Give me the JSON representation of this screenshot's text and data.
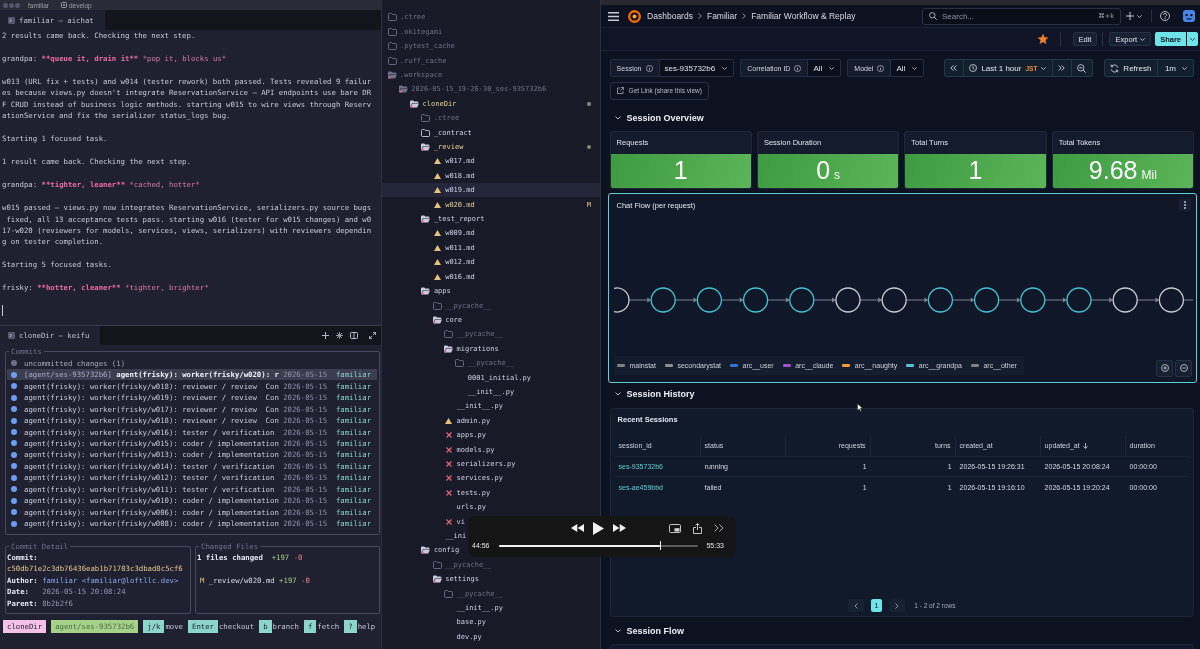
{
  "terminal_window": {
    "title": "familiar",
    "branch": "develop"
  },
  "chat_pane": {
    "tab": "familiar — aichat",
    "lines": [
      {
        "kind": "text",
        "text": "2 results came back. Checking the next step."
      },
      {
        "kind": "voice",
        "speaker": "grandpa:",
        "strong": "**queue it, drain it**",
        "soft": "*pop it, blocks us*"
      },
      {
        "kind": "text",
        "text": "w013 (URL fix + tests) and w014 (tester rework) both passed. Tests revealed 9 failures because views.py doesn't integrate ReservationService — API endpoints use bare DRF CRUD instead of business logic methods. starting w015 to wire views through ReservationService and fix the serializer status_logs bug."
      },
      {
        "kind": "text",
        "text": "Starting 1 focused task."
      },
      {
        "kind": "text",
        "text": "1 result came back. Checking the next step."
      },
      {
        "kind": "voice",
        "speaker": "grandpa:",
        "strong": "**tighter, leaner**",
        "soft": "*cached, hotter*"
      },
      {
        "kind": "text",
        "text": "w015 passed — views.py now integrates ReservationService, serializers.py source bugs fixed, all 13 acceptance tests pass. starting w016 (tester for w015 changes) and w017-w020 (reviewers for models, services, views, serializers) with reviewers depending on tester completion."
      },
      {
        "kind": "text",
        "text": "Starting 5 focused tasks."
      },
      {
        "kind": "voice",
        "speaker": "frisky:",
        "strong": "**hotter, cleaner**",
        "soft": "*tighter, brighter*"
      }
    ]
  },
  "git_pane": {
    "tab": "cloneDir — keifu",
    "commits": {
      "title": "Commits",
      "items": [
        {
          "kind": "pending",
          "message": "uncommitted changes (1)",
          "selected": false
        },
        {
          "kind": "commit",
          "ref": "[agent/ses-935732b6]",
          "message": "agent(frisky): worker(frisky/w020): r",
          "date": "2026-05-15",
          "author": "familiar",
          "selected": true
        },
        {
          "kind": "commit",
          "message": "agent(frisky): worker(frisky/w018): reviewer / review  Con",
          "date": "2026-05-15",
          "author": "familiar",
          "selected": false
        },
        {
          "kind": "commit",
          "message": "agent(frisky): worker(frisky/w019): reviewer / review  Con",
          "date": "2026-05-15",
          "author": "familiar",
          "selected": false
        },
        {
          "kind": "commit",
          "message": "agent(frisky): worker(frisky/w017): reviewer / review  Con",
          "date": "2026-05-15",
          "author": "familiar",
          "selected": false
        },
        {
          "kind": "commit",
          "message": "agent(frisky): worker(frisky/w018): reviewer / review  Con",
          "date": "2026-05-15",
          "author": "familiar",
          "selected": false
        },
        {
          "kind": "commit",
          "message": "agent(frisky): worker(frisky/w016): tester / verification",
          "date": "2026-05-15",
          "author": "familiar",
          "selected": false
        },
        {
          "kind": "commit",
          "message": "agent(frisky): worker(frisky/w015): coder / implementation",
          "date": "2026-05-15",
          "author": "familiar",
          "selected": false
        },
        {
          "kind": "commit",
          "message": "agent(frisky): worker(frisky/w013): coder / implementation",
          "date": "2026-05-15",
          "author": "familiar",
          "selected": false
        },
        {
          "kind": "commit",
          "message": "agent(frisky): worker(frisky/w014): tester / verification",
          "date": "2026-05-15",
          "author": "familiar",
          "selected": false
        },
        {
          "kind": "commit",
          "message": "agent(frisky): worker(frisky/w012): tester / verification",
          "date": "2026-05-15",
          "author": "familiar",
          "selected": false
        },
        {
          "kind": "commit",
          "message": "agent(frisky): worker(frisky/w011): tester / verification",
          "date": "2026-05-15",
          "author": "familiar",
          "selected": false
        },
        {
          "kind": "commit",
          "message": "agent(frisky): worker(frisky/w010): coder / implementation",
          "date": "2026-05-15",
          "author": "familiar",
          "selected": false
        },
        {
          "kind": "commit",
          "message": "agent(frisky): worker(frisky/w006): coder / implementation",
          "date": "2026-05-15",
          "author": "familiar",
          "selected": false
        },
        {
          "kind": "commit",
          "message": "agent(frisky): worker(frisky/w008): coder / implementation",
          "date": "2026-05-15",
          "author": "familiar",
          "selected": false
        }
      ]
    },
    "detail": {
      "title": "Commit Detail",
      "fields": [
        {
          "label": "Commit:",
          "value": "c50db71e2c3db76436eab1b71703c3dbad8c5cf6",
          "kind": "hash"
        },
        {
          "label": "Author:",
          "value": "familiar <familiar@loftllc.dev>",
          "kind": "author"
        },
        {
          "label": "Date:",
          "value": "2026-05-15 20:08:24",
          "kind": "plain"
        },
        {
          "label": "Parent:",
          "value": "8b2b2f6",
          "kind": "plain"
        }
      ]
    },
    "changes": {
      "title": "Changed Files",
      "summary": "1 files changed",
      "added": "+197",
      "removed": "-0",
      "files": [
        {
          "status": "M",
          "path": "_review/w020.md",
          "added": "+197",
          "removed": "-0"
        }
      ]
    },
    "status_bar": [
      {
        "kind": "dir",
        "text": "cloneDir"
      },
      {
        "kind": "branch",
        "text": "agent/ses-935732b6"
      },
      {
        "kind": "key",
        "key": "j/k",
        "label": "move"
      },
      {
        "kind": "key",
        "key": "Enter",
        "label": "checkout"
      },
      {
        "kind": "key",
        "key": "b",
        "label": "branch"
      },
      {
        "kind": "key",
        "key": "f",
        "label": "fetch"
      },
      {
        "kind": "key",
        "key": "?",
        "label": "help"
      }
    ]
  },
  "file_tree": {
    "items": [
      {
        "name": ".ctree",
        "kind": "folder",
        "expanded": false,
        "ignored": true,
        "modified": false,
        "selected": false
      },
      {
        "name": ".okitegami",
        "kind": "folder",
        "expanded": false,
        "ignored": true,
        "modified": false,
        "selected": false
      },
      {
        "name": ".pytest_cache",
        "kind": "folder",
        "expanded": false,
        "ignored": true,
        "modified": false,
        "selected": false
      },
      {
        "name": ".ruff_cache",
        "kind": "folder",
        "expanded": false,
        "ignored": true,
        "modified": false,
        "selected": false
      },
      {
        "name": ".workspace",
        "kind": "folder",
        "expanded": true,
        "ignored": true,
        "modified": false,
        "selected": false,
        "children": [
          {
            "name": "2026-05-15_19-26-30_ses-935732b6",
            "kind": "folder",
            "expanded": true,
            "ignored": true,
            "modified": false,
            "selected": false,
            "children": [
              {
                "name": "cloneDir",
                "kind": "folder",
                "expanded": true,
                "ignored": false,
                "modified": true,
                "selected": false,
                "children": [
                  {
                    "name": ".ctree",
                    "kind": "folder",
                    "expanded": false,
                    "ignored": true,
                    "modified": false,
                    "selected": false
                  },
                  {
                    "name": "_contract",
                    "kind": "folder",
                    "expanded": false,
                    "ignored": false,
                    "modified": false,
                    "selected": false
                  },
                  {
                    "name": "_review",
                    "kind": "folder",
                    "expanded": true,
                    "ignored": false,
                    "modified": true,
                    "selected": false,
                    "children": [
                      {
                        "name": "w017.md",
                        "kind": "warning",
                        "ignored": false,
                        "modified": false,
                        "selected": false
                      },
                      {
                        "name": "w018.md",
                        "kind": "warning",
                        "ignored": false,
                        "modified": false,
                        "selected": false
                      },
                      {
                        "name": "w019.md",
                        "kind": "warning",
                        "ignored": false,
                        "modified": false,
                        "selected": true
                      },
                      {
                        "name": "w020.md",
                        "kind": "warning",
                        "ignored": false,
                        "modified": true,
                        "badge": "M",
                        "selected": false
                      }
                    ]
                  },
                  {
                    "name": "_test_report",
                    "kind": "folder",
                    "expanded": true,
                    "ignored": false,
                    "modified": false,
                    "selected": false,
                    "children": [
                      {
                        "name": "w009.md",
                        "kind": "warning",
                        "ignored": false,
                        "modified": false,
                        "selected": false
                      },
                      {
                        "name": "w011.md",
                        "kind": "warning",
                        "ignored": false,
                        "modified": false,
                        "selected": false
                      },
                      {
                        "name": "w012.md",
                        "kind": "warning",
                        "ignored": false,
                        "modified": false,
                        "selected": false
                      },
                      {
                        "name": "w016.md",
                        "kind": "warning",
                        "ignored": false,
                        "modified": false,
                        "selected": false
                      }
                    ]
                  },
                  {
                    "name": "apps",
                    "kind": "folder",
                    "expanded": true,
                    "ignored": false,
                    "modified": false,
                    "selected": false,
                    "children": [
                      {
                        "name": "__pycache__",
                        "kind": "folder",
                        "expanded": false,
                        "ignored": true,
                        "modified": false,
                        "selected": false
                      },
                      {
                        "name": "core",
                        "kind": "folder",
                        "expanded": true,
                        "ignored": false,
                        "modified": false,
                        "selected": false,
                        "children": [
                          {
                            "name": "__pycache__",
                            "kind": "folder",
                            "expanded": false,
                            "ignored": true,
                            "modified": false,
                            "selected": false
                          },
                          {
                            "name": "migrations",
                            "kind": "folder",
                            "expanded": true,
                            "ignored": false,
                            "modified": false,
                            "selected": false,
                            "children": [
                              {
                                "name": "__pycache__",
                                "kind": "folder",
                                "expanded": false,
                                "ignored": true,
                                "modified": false,
                                "selected": false
                              },
                              {
                                "name": "0001_initial.py",
                                "kind": "plain",
                                "ignored": false,
                                "modified": false,
                                "selected": false
                              },
                              {
                                "name": "__init__.py",
                                "kind": "plain",
                                "ignored": false,
                                "modified": false,
                                "selected": false
                              }
                            ]
                          },
                          {
                            "name": "__init__.py",
                            "kind": "plain",
                            "ignored": false,
                            "modified": false,
                            "selected": false
                          },
                          {
                            "name": "admin.py",
                            "kind": "warning",
                            "ignored": false,
                            "modified": false,
                            "selected": false
                          },
                          {
                            "name": "apps.py",
                            "kind": "error",
                            "ignored": false,
                            "modified": false,
                            "selected": false
                          },
                          {
                            "name": "models.py",
                            "kind": "error",
                            "ignored": false,
                            "modified": false,
                            "selected": false
                          },
                          {
                            "name": "serializers.py",
                            "kind": "error",
                            "ignored": false,
                            "modified": false,
                            "selected": false
                          },
                          {
                            "name": "services.py",
                            "kind": "error",
                            "ignored": false,
                            "modified": false,
                            "selected": false
                          },
                          {
                            "name": "tests.py",
                            "kind": "error",
                            "ignored": false,
                            "modified": false,
                            "selected": false
                          },
                          {
                            "name": "urls.py",
                            "kind": "plain",
                            "ignored": false,
                            "modified": false,
                            "selected": false
                          },
                          {
                            "name": "vi",
                            "kind": "error",
                            "ignored": false,
                            "modified": false,
                            "selected": false
                          }
                        ]
                      },
                      {
                        "name": "__ini",
                        "kind": "plain",
                        "ignored": false,
                        "modified": false,
                        "selected": false
                      }
                    ]
                  },
                  {
                    "name": "config",
                    "kind": "folder",
                    "expanded": true,
                    "ignored": false,
                    "modified": false,
                    "selected": false,
                    "children": [
                      {
                        "name": "__pycache__",
                        "kind": "folder",
                        "expanded": false,
                        "ignored": true,
                        "modified": false,
                        "selected": false
                      },
                      {
                        "name": "settings",
                        "kind": "folder",
                        "expanded": true,
                        "ignored": false,
                        "modified": false,
                        "selected": false,
                        "children": [
                          {
                            "name": "__pycache__",
                            "kind": "folder",
                            "expanded": false,
                            "ignored": true,
                            "modified": false,
                            "selected": false
                          },
                          {
                            "name": "__init__.py",
                            "kind": "plain",
                            "ignored": false,
                            "modified": false,
                            "selected": false
                          },
                          {
                            "name": "base.py",
                            "kind": "plain",
                            "ignored": false,
                            "modified": false,
                            "selected": false
                          },
                          {
                            "name": "dev.py",
                            "kind": "plain",
                            "ignored": false,
                            "modified": false,
                            "selected": false
                          }
                        ]
                      }
                    ]
                  }
                ]
              }
            ]
          }
        ]
      }
    ]
  },
  "dashboard": {
    "breadcrumbs": [
      "Dashboards",
      "Familiar",
      "Familiar Workflow & Replay"
    ],
    "search": {
      "placeholder": "Search...",
      "shortcut": "⌘+k"
    },
    "toolbar": {
      "starred": true,
      "buttons": [
        {
          "label": "Edit",
          "kind": "plain"
        },
        {
          "label": "Export",
          "kind": "menu"
        },
        {
          "label": "Share",
          "kind": "split"
        }
      ]
    },
    "variables": [
      {
        "label": "Session",
        "value": "ses-935732b6"
      },
      {
        "label": "Correlation ID",
        "value": "All"
      },
      {
        "label": "Model",
        "value": "All"
      }
    ],
    "time_range": {
      "label": "Last 1 hour",
      "zone": "JST"
    },
    "refresh": {
      "label": "Refresh",
      "interval": "1m"
    },
    "link_button": "Get Link (share this view)",
    "overview": {
      "title": "Session Overview",
      "expanded": true,
      "stats": [
        {
          "title": "Requests",
          "value": "1"
        },
        {
          "title": "Session Duration",
          "value": "0",
          "unit": "s"
        },
        {
          "title": "Total Turns",
          "value": "1"
        },
        {
          "title": "Total Tokens",
          "value": "9.68",
          "unit": "Mil"
        }
      ]
    },
    "chat_flow": {
      "title": "Chat Flow (per request)",
      "focused": true,
      "nodes": [
        {
          "color": "#c9cacf",
          "cut": true
        },
        {
          "color": "#3ec5d6",
          "cut": false
        },
        {
          "color": "#3ec5d6",
          "cut": false
        },
        {
          "color": "#3ec5d6",
          "cut": false
        },
        {
          "color": "#3ec5d6",
          "cut": false
        },
        {
          "color": "#c9cacf",
          "cut": false
        },
        {
          "color": "#c9cacf",
          "cut": false
        },
        {
          "color": "#3ec5d6",
          "cut": false
        },
        {
          "color": "#3ec5d6",
          "cut": false
        },
        {
          "color": "#3ec5d6",
          "cut": false
        },
        {
          "color": "#3ec5d6",
          "cut": false
        },
        {
          "color": "#c9cacf",
          "cut": false
        },
        {
          "color": "#c9cacf",
          "cut": false
        }
      ],
      "legend": [
        {
          "label": "mainstat",
          "color": "#808080"
        },
        {
          "label": "secondarystat",
          "color": "#8e8e8e"
        },
        {
          "label": "arc__user",
          "color": "#3274d9"
        },
        {
          "label": "arc__claude",
          "color": "#a352cc"
        },
        {
          "label": "arc__naughty",
          "color": "#ff9830"
        },
        {
          "label": "arc__grandpa",
          "color": "#56c3d6"
        },
        {
          "label": "arc__other",
          "color": "#808080"
        }
      ]
    },
    "history": {
      "title": "Session History",
      "expanded": true,
      "table": {
        "title": "Recent Sessions",
        "columns": [
          {
            "label": "session_id",
            "kind": "link",
            "sorted": false
          },
          {
            "label": "status",
            "kind": "text",
            "sorted": false
          },
          {
            "label": "requests",
            "kind": "number",
            "sorted": false
          },
          {
            "label": "turns",
            "kind": "number",
            "sorted": false
          },
          {
            "label": "created_at",
            "kind": "text",
            "sorted": false
          },
          {
            "label": "updated_at",
            "kind": "text",
            "sorted": true
          },
          {
            "label": "duration",
            "kind": "text",
            "sorted": false
          }
        ],
        "rows": [
          [
            "ses-935732b6",
            "running",
            "1",
            "1",
            "2026-05-15 19:26:31",
            "2026-05-15 20:08:24",
            "00:00:00"
          ],
          [
            "ses-ae459bbd",
            "failed",
            "1",
            "1",
            "2026-05-15 19:16:10",
            "2026-05-15 19:20:24",
            "00:00:00"
          ]
        ]
      },
      "pagination": {
        "pages": [
          {
            "label": "1",
            "selected": true
          }
        ],
        "summary": "1 - 2 of 2 rows"
      }
    },
    "session_flow": {
      "title": "Session Flow",
      "expanded": true
    }
  },
  "video_player": {
    "elapsed": "44:56",
    "duration": "55:33",
    "level": 0.81,
    "playing": false
  }
}
